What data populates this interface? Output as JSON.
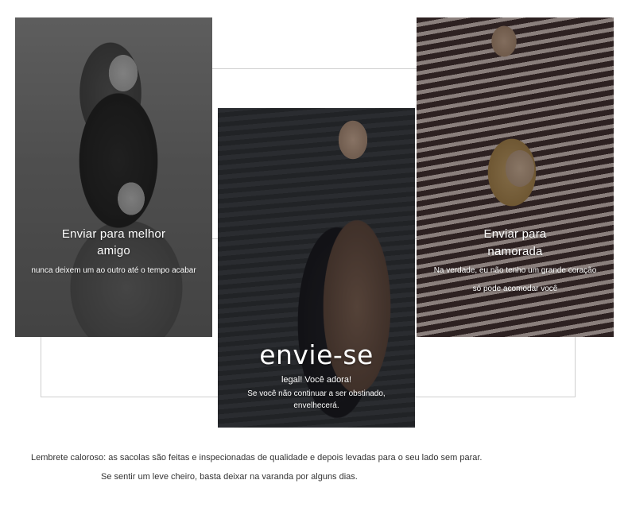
{
  "cards": {
    "friend": {
      "title_line1": "Enviar para melhor",
      "title_line2": "amigo",
      "subtitle": "nunca deixem um ao outro até o tempo acabar"
    },
    "self": {
      "title": "envie-se",
      "line1": "legal! Você adora!",
      "line2": "Se você não continuar a ser obstinado,",
      "line3": "envelhecerá."
    },
    "girlfriend": {
      "title_line1": "Enviar para",
      "title_line2": "namorada",
      "subtitle_line1": "Na verdade, eu não tenho um grande coração",
      "subtitle_line2": "só pode acomodar você"
    }
  },
  "footer": {
    "line1": "Lembrete caloroso: as sacolas são feitas e inspecionadas de qualidade e depois levadas para o seu lado sem parar.",
    "line2": "Se sentir um leve cheiro, basta deixar na varanda por alguns dias."
  }
}
